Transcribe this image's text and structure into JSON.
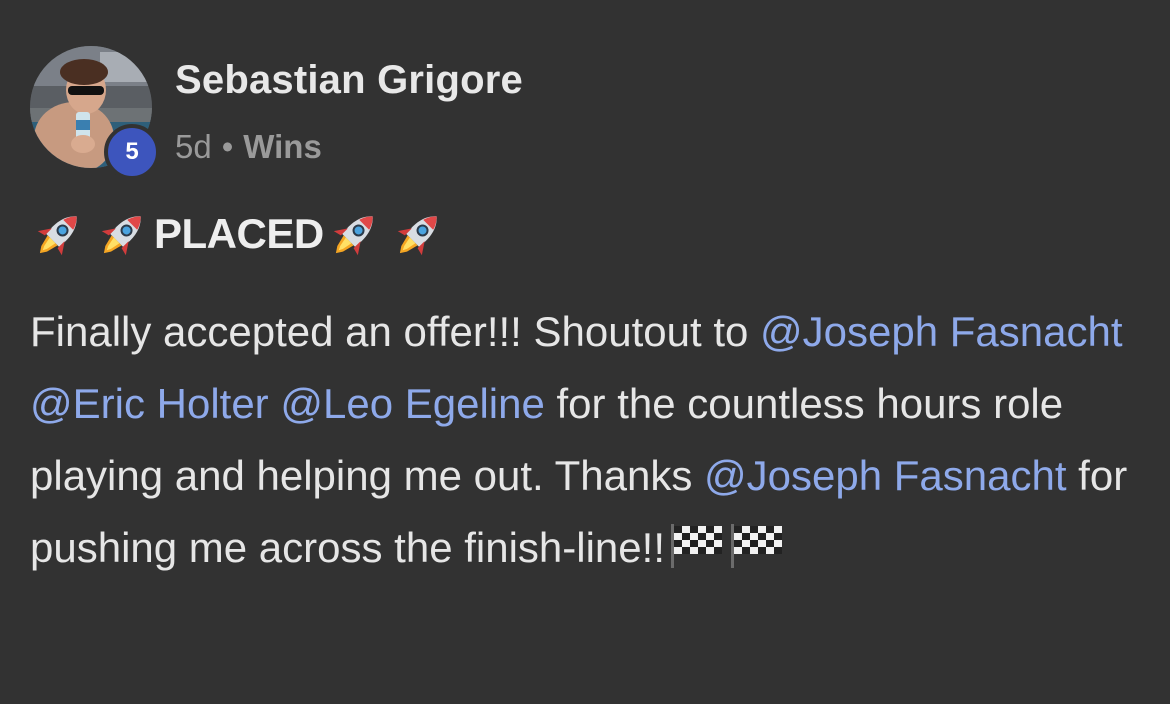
{
  "post": {
    "author": {
      "name": "Sebastian Grigore",
      "avatar_icon": "user-avatar-photo",
      "level": "5"
    },
    "meta": {
      "age": "5d",
      "separator": "•",
      "category": "Wins"
    },
    "title": {
      "text": "PLACED",
      "emoji_icon": "rocket-icon"
    },
    "body": {
      "seg1": "Finally accepted an offer!!! Shoutout to ",
      "mention1": "@Joseph Fasnacht",
      "seg2": " ",
      "mention2": "@Eric Holter",
      "seg3": " ",
      "mention3": "@Leo Egeline",
      "seg4": " for the countless hours role playing and helping me out. Thanks ",
      "mention4": "@Joseph Fasnacht",
      "seg5": " for pushing me across the finish-line!!",
      "emoji_icon": "checkered-flag-icon"
    },
    "colors": {
      "background": "#323232",
      "mention": "#8ea9ea",
      "level_badge": "#3d55bd",
      "text": "#e6e6e6",
      "meta": "#9a9a9a"
    }
  }
}
